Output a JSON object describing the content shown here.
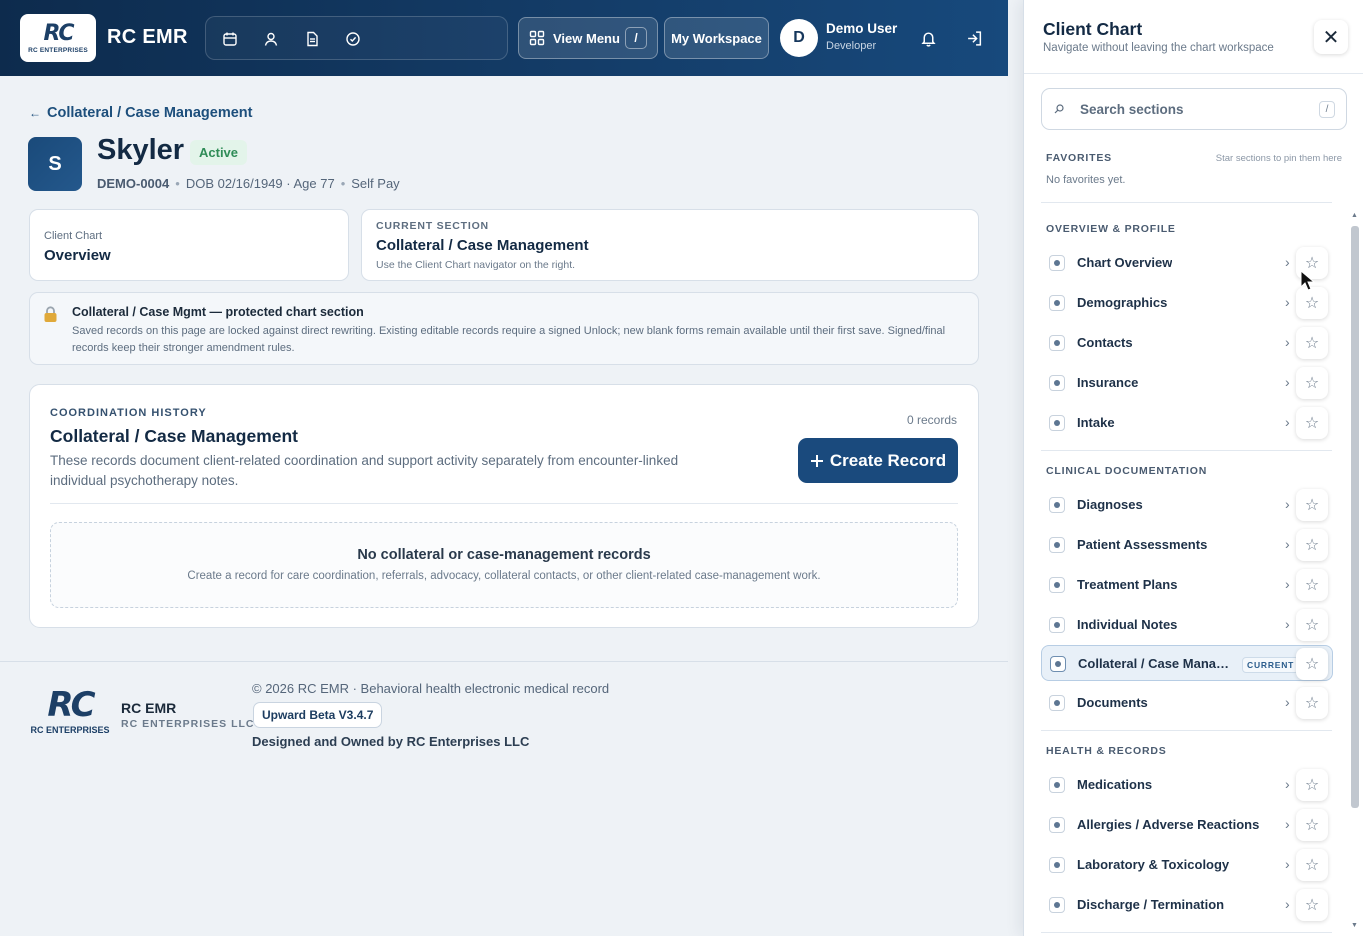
{
  "header": {
    "logo_text": "RC",
    "logo_sub": "RC ENTERPRISES",
    "app_name": "RC EMR",
    "icons": [
      "calendar-icon",
      "user-icon",
      "document-icon",
      "clock-check-icon"
    ],
    "view_menu_label": "View Menu",
    "view_menu_shortcut": "/",
    "workspace_label": "My Workspace",
    "user_initial": "D",
    "user_name": "Demo User",
    "user_role": "Developer"
  },
  "patient": {
    "back_label": "Collateral / Case Management",
    "initial": "S",
    "name": "Skyler",
    "status": "Active",
    "id": "DEMO-0004",
    "dob_age": "DOB 02/16/1949 · Age 77",
    "payer": "Self Pay"
  },
  "cards": {
    "chart_label": "Client Chart",
    "chart_value": "Overview",
    "section_label": "CURRENT SECTION",
    "section_value": "Collateral / Case Management",
    "section_hint": "Use the Client Chart navigator on the right."
  },
  "notice": {
    "title": "Collateral / Case Mgmt — protected chart section",
    "body": "Saved records on this page are locked against direct rewriting. Existing editable records require a signed Unlock; new blank forms remain available until their first save. Signed/final records keep their stronger amendment rules."
  },
  "history": {
    "caption": "COORDINATION HISTORY",
    "title": "Collateral / Case Management",
    "description": "These records document client-related coordination and support activity separately from encounter-linked individual psychotherapy notes.",
    "count": "0 records",
    "create_label": "Create Record",
    "empty_title": "No collateral or case-management records",
    "empty_desc": "Create a record for care coordination, referrals, advocacy, collateral contacts, or other client-related case-management work."
  },
  "footer": {
    "logo_text": "RC",
    "logo_sub": "RC ENTERPRISES",
    "name": "RC EMR",
    "company": "RC ENTERPRISES LLC",
    "copyright": "© 2026 RC EMR · Behavioral health electronic medical record",
    "version": "Upward Beta V3.4.7",
    "owner": "Designed and Owned by RC Enterprises LLC"
  },
  "drawer": {
    "title": "Client Chart",
    "subtitle": "Navigate without leaving the chart workspace",
    "search_placeholder": "Search sections",
    "search_shortcut": "/",
    "favorites_heading": "FAVORITES",
    "favorites_hint": "Star sections to pin them here",
    "favorites_empty": "No favorites yet.",
    "current_tag": "CURRENT",
    "groups": [
      {
        "heading": "OVERVIEW & PROFILE",
        "items": [
          "Chart Overview",
          "Demographics",
          "Contacts",
          "Insurance",
          "Intake"
        ]
      },
      {
        "heading": "CLINICAL DOCUMENTATION",
        "items": [
          "Diagnoses",
          "Patient Assessments",
          "Treatment Plans",
          "Individual Notes",
          "Collateral / Case Management",
          "Documents"
        ]
      },
      {
        "heading": "HEALTH & RECORDS",
        "items": [
          "Medications",
          "Allergies / Adverse Reactions",
          "Laboratory & Toxicology",
          "Discharge / Termination"
        ]
      }
    ]
  }
}
